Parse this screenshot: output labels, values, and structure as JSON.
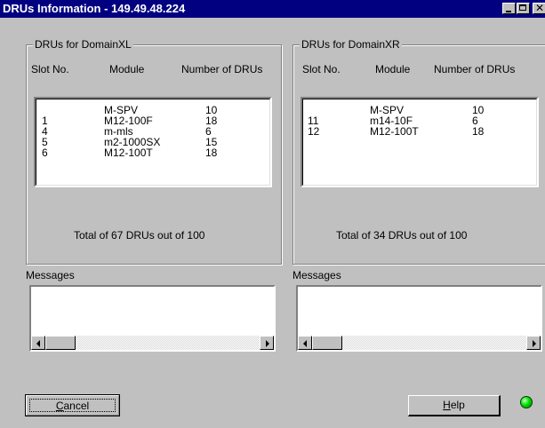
{
  "window": {
    "title": "DRUs Information - 149.49.48.224"
  },
  "left_panel": {
    "legend": "DRUs for DomainXL",
    "columns": [
      "Slot No.",
      "Module",
      "Number of DRUs"
    ],
    "rows": [
      {
        "slot": "",
        "module": "M-SPV",
        "count": "10"
      },
      {
        "slot": "1",
        "module": "M12-100F",
        "count": "18"
      },
      {
        "slot": "4",
        "module": "m-mls",
        "count": "6"
      },
      {
        "slot": "5",
        "module": "m2-1000SX",
        "count": "15"
      },
      {
        "slot": "6",
        "module": "M12-100T",
        "count": "18"
      }
    ],
    "total_text": "Total of  67  DRUs out of 100"
  },
  "right_panel": {
    "legend": "DRUs for DomainXR",
    "columns": [
      "Slot No.",
      "Module",
      "Number of DRUs"
    ],
    "rows": [
      {
        "slot": "",
        "module": "M-SPV",
        "count": "10"
      },
      {
        "slot": "11",
        "module": "m14-10F",
        "count": "6"
      },
      {
        "slot": "12",
        "module": "M12-100T",
        "count": "18"
      }
    ],
    "total_text": "Total of  34  DRUs out of 100"
  },
  "messages": {
    "left_label": "Messages",
    "right_label": "Messages"
  },
  "buttons": {
    "cancel_rest": "ancel",
    "cancel_key": "C",
    "help_rest": "elp",
    "help_key": "H"
  },
  "status": {
    "led_color": "#00e000"
  }
}
